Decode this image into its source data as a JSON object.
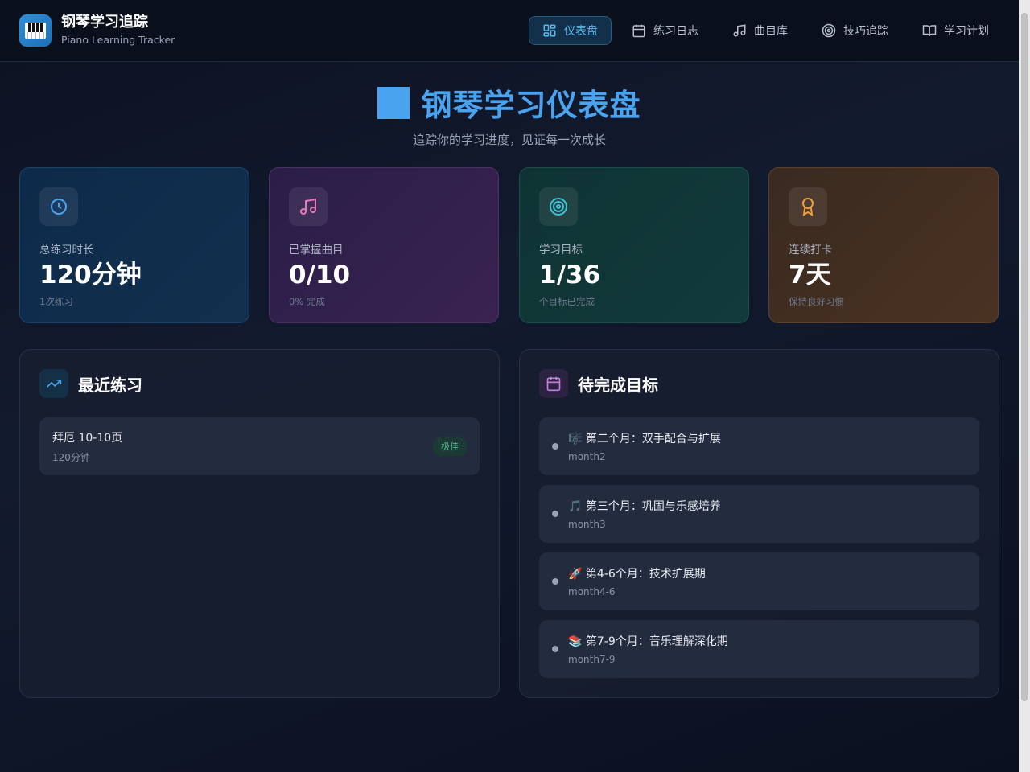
{
  "brand": {
    "title": "钢琴学习追踪",
    "subtitle": "Piano Learning Tracker"
  },
  "nav": [
    {
      "label": "仪表盘",
      "icon": "dashboard-icon",
      "active": true
    },
    {
      "label": "练习日志",
      "icon": "calendar-icon"
    },
    {
      "label": "曲目库",
      "icon": "music-note-icon"
    },
    {
      "label": "技巧追踪",
      "icon": "target-icon"
    },
    {
      "label": "学习计划",
      "icon": "book-icon"
    }
  ],
  "hero": {
    "title": "钢琴学习仪表盘",
    "subtitle": "追踪你的学习进度，见证每一次成长"
  },
  "stats": [
    {
      "label": "总练习时长",
      "value": "120分钟",
      "note": "1次练习",
      "icon": "clock-icon",
      "color": "#4aa3ef"
    },
    {
      "label": "已掌握曲目",
      "value": "0/10",
      "note": "0% 完成",
      "icon": "music-note-icon",
      "color": "#e879b9"
    },
    {
      "label": "学习目标",
      "value": "1/36",
      "note": "个目标已完成",
      "icon": "target-icon",
      "color": "#3fc1d6"
    },
    {
      "label": "连续打卡",
      "value": "7天",
      "note": "保持良好习惯",
      "icon": "award-icon",
      "color": "#f0a03a"
    }
  ],
  "recent": {
    "title": "最近练习",
    "items": [
      {
        "title": "拜厄 10-10页",
        "sub": "120分钟",
        "badge": "极佳"
      }
    ]
  },
  "goals": {
    "title": "待完成目标",
    "items": [
      {
        "title": "🎼 第二个月：双手配合与扩展",
        "sub": "month2"
      },
      {
        "title": "🎵 第三个月：巩固与乐感培养",
        "sub": "month3"
      },
      {
        "title": "🚀 第4-6个月：技术扩展期",
        "sub": "month4-6"
      },
      {
        "title": "📚 第7-9个月：音乐理解深化期",
        "sub": "month7-9"
      }
    ]
  }
}
